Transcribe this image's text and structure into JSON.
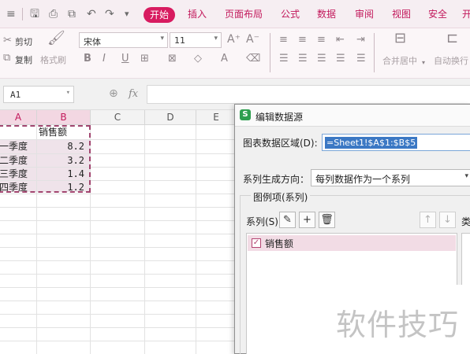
{
  "menubar": {
    "items": [
      "开始",
      "插入",
      "页面布局",
      "公式",
      "数据",
      "审阅",
      "视图",
      "安全",
      "开"
    ],
    "active": "开始",
    "quick_icons": [
      "save-icon",
      "print-icon",
      "print-preview-icon",
      "undo-icon",
      "redo-icon",
      "quick-access-dropdown-icon"
    ]
  },
  "ribbon": {
    "cut_label": "剪切",
    "copy_label": "复制",
    "format_painter_label": "格式刷",
    "font_name": "宋体",
    "font_size": "11",
    "bold": "B",
    "italic": "I",
    "underline": "U",
    "merge_label": "合并居中",
    "wrap_label": "自动换行"
  },
  "formula_bar": {
    "cell_ref": "A1",
    "fx": "fx"
  },
  "sheet": {
    "columns": [
      "A",
      "B",
      "C",
      "D",
      "E"
    ],
    "rows": [
      {
        "a": "",
        "b": "销售额"
      },
      {
        "a": "一季度",
        "b": "8.2"
      },
      {
        "a": "二季度",
        "b": "3.2"
      },
      {
        "a": "三季度",
        "b": "1.4"
      },
      {
        "a": "四季度",
        "b": "1.2"
      }
    ]
  },
  "dialog": {
    "title": "编辑数据源",
    "range_label": "图表数据区域(D):",
    "range_value": "=Sheet1!$A$1:$B$5",
    "direction_label": "系列生成方向：",
    "direction_value": "每列数据作为一个系列",
    "legend_group": "图例项(系列)",
    "series_label": "系列(S)",
    "series_items": [
      "销售额"
    ],
    "right_group_label": "类"
  },
  "watermark": "软件技巧",
  "colors": {
    "accent": "#d81b60",
    "selection": "#3b78c4",
    "marquee": "#a1456f"
  }
}
